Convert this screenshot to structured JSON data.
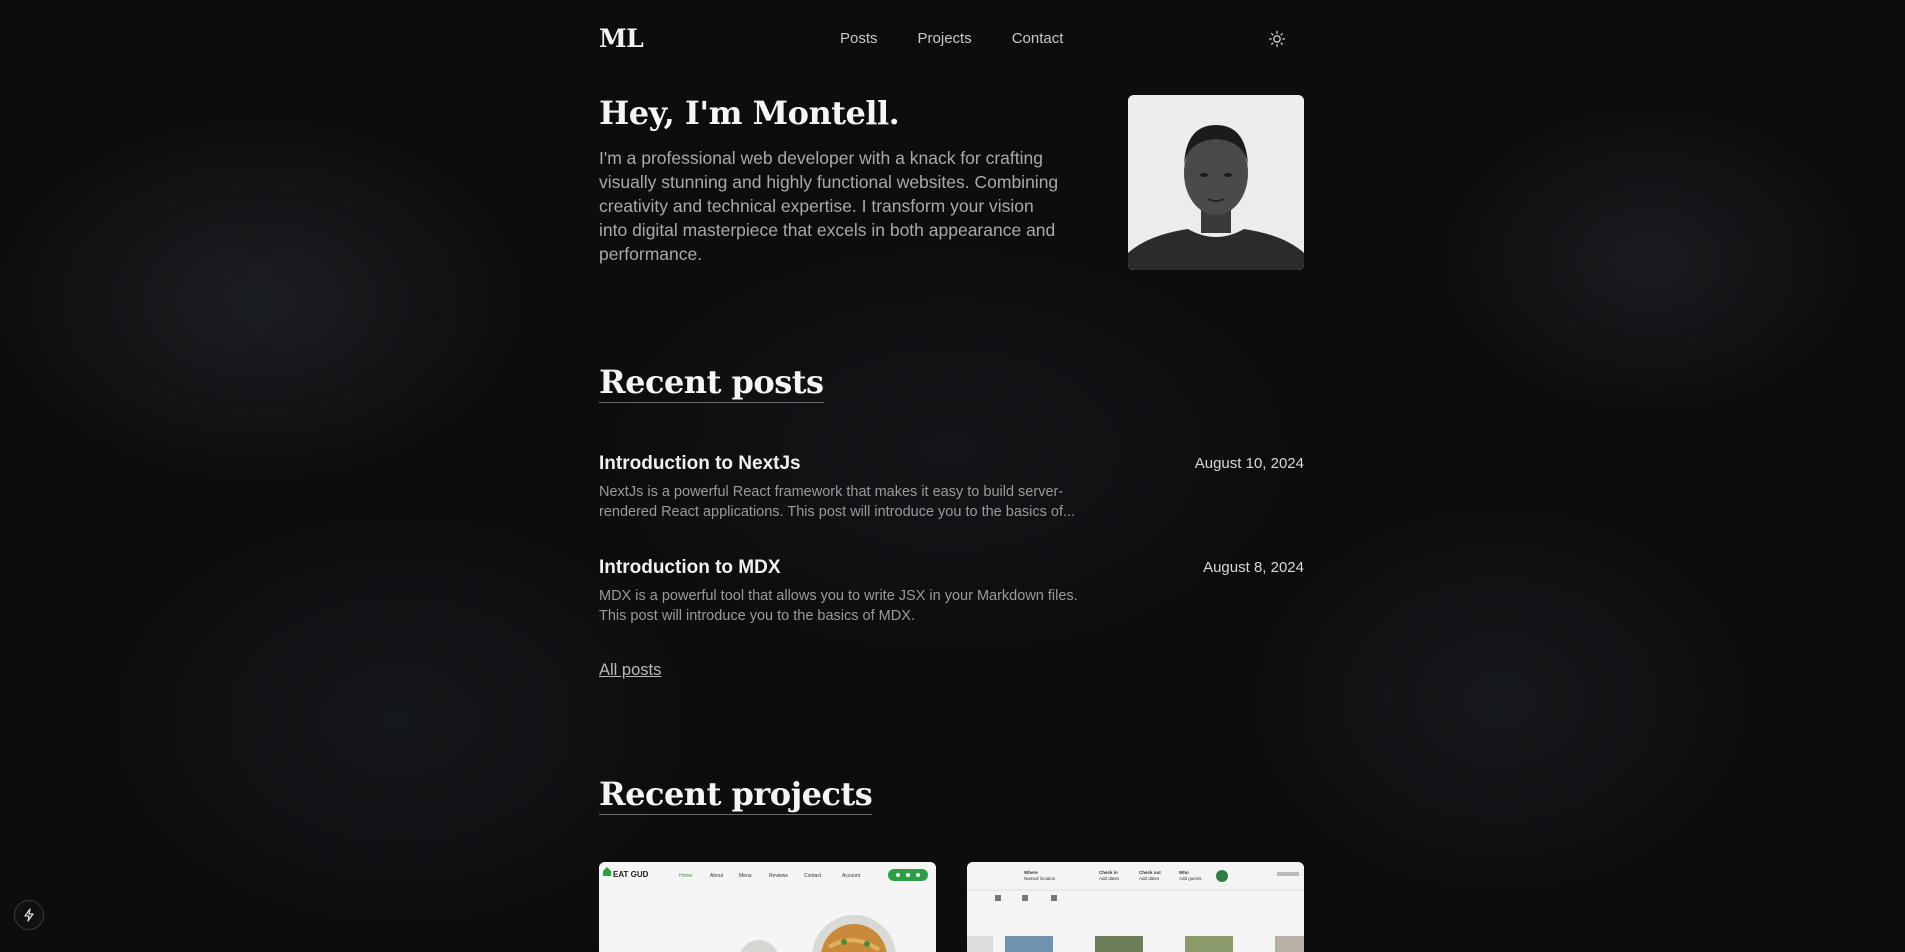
{
  "nav": {
    "logo": "ML",
    "links": [
      "Posts",
      "Projects",
      "Contact"
    ],
    "theme_icon": "sun-icon"
  },
  "hero": {
    "heading": "Hey, I'm Montell.",
    "bio": "I'm a professional web developer with a knack for crafting visually stunning and highly functional websites. Combining creativity and technical expertise. I transform your vision into digital masterpiece that excels in both appearance and performance."
  },
  "recent_posts": {
    "title": "Recent posts",
    "items": [
      {
        "title": "Introduction to NextJs",
        "date": "August 10, 2024",
        "excerpt": "NextJs is a powerful React framework that makes it easy to build server-rendered React applications. This post will introduce you to the basics of..."
      },
      {
        "title": "Introduction to MDX",
        "date": "August 8, 2024",
        "excerpt": "MDX is a powerful tool that allows you to write JSX in your Markdown files. This post will introduce you to the basics of MDX."
      }
    ],
    "all_posts_label": "All posts"
  },
  "recent_projects": {
    "title": "Recent projects",
    "cards": [
      {
        "brand": "EAT GUD",
        "nav": [
          "Home",
          "About",
          "Menu",
          "Reviews",
          "Contact",
          "Account"
        ]
      },
      {
        "fields": [
          "Where",
          "Check in",
          "Check out",
          "Who"
        ],
        "values": [
          "Named location",
          "Add dates",
          "Add dates",
          "Add guests"
        ]
      }
    ]
  },
  "colors": {
    "background": "#0c0d0f",
    "accent_green": "#2e9e46"
  },
  "floating_button_icon": "bolt-icon"
}
